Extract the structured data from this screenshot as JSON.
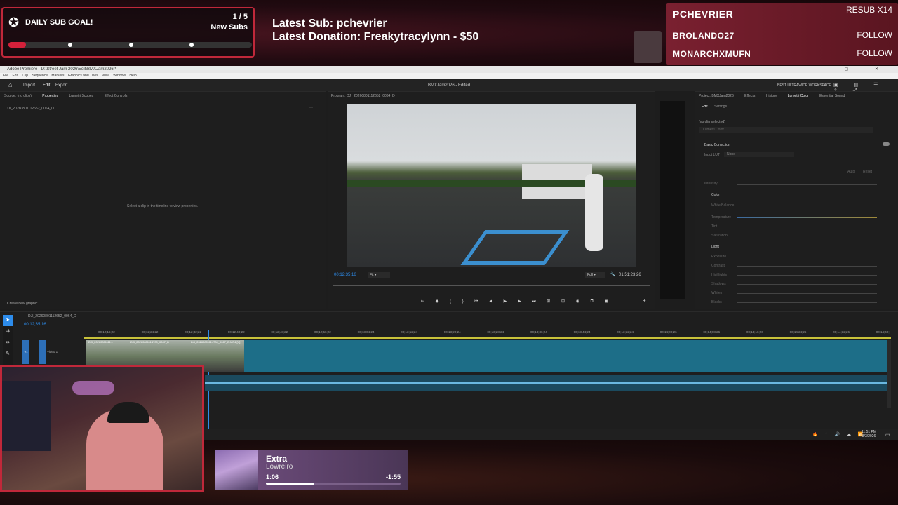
{
  "overlay": {
    "goal": {
      "title": "DAILY SUB GOAL!",
      "count": "1 / 5",
      "label": "New Subs",
      "progress": 0.2
    },
    "latest_sub": "Latest Sub: pchevrier",
    "latest_donation": "Latest Donation: Freakytracylynn  - $50",
    "events": [
      {
        "name": "PCHEVRIER",
        "type": "RESUB X14"
      },
      {
        "name": "BROLANDO27",
        "type": "FOLLOW"
      },
      {
        "name": "MONARCHXMUFN",
        "type": "FOLLOW"
      }
    ]
  },
  "app": {
    "window_title": "Adobe Premiere - D:\\Street Jam 2026\\Edit\\BMXJam2026 *",
    "menu": [
      "File",
      "Edit",
      "Clip",
      "Sequence",
      "Markers",
      "Graphics and Titles",
      "View",
      "Window",
      "Help"
    ],
    "toolbar": {
      "import": "Import",
      "edit": "Edit",
      "export": "Export",
      "project_title": "BMXJam2026 - Edited",
      "workspace": "BEST ULTRAWIDE WORKSPACE"
    },
    "left_tabs": [
      "Source: (no clips)",
      "Properties",
      "Lumetri Scopes",
      "Effect Controls"
    ],
    "clip_name": "DJI_20260801112652_0064_D",
    "properties_empty": "Select a clip in the timeline to view properties.",
    "create_graphic": "Create new graphic",
    "program_tab": "Program: DJI_20260801112652_0064_D",
    "timecode_current": "00;12;35;16",
    "fit": "Fit",
    "full": "Full",
    "timecode_duration": "01;51;23;26",
    "right_tabs": [
      "Project: BMXJam2026",
      "Effects",
      "History",
      "Lumetri Color",
      "Essential Sound"
    ],
    "lumetri": {
      "edit": "Edit",
      "settings": "Settings",
      "no_clip": "(no clip selected)",
      "lumetri_color": "Lumetri Color",
      "basic_correction": "Basic Correction",
      "input_lut": "Input LUT",
      "none": "None",
      "auto": "Auto",
      "reset": "Reset",
      "intensity": "Intensity",
      "color": "Color",
      "white_balance": "White Balance",
      "color_sliders": [
        "Temperature",
        "Tint",
        "Saturation"
      ],
      "light": "Light",
      "light_sliders": [
        "Exposure",
        "Contrast",
        "Highlights",
        "Shadows",
        "Whites",
        "Blacks"
      ]
    },
    "sequence_tab": "DJI_20260801112652_0064_D",
    "seq_timecode": "00;12;35;16",
    "ruler": [
      "00;12;16;22",
      "00;12;24;22",
      "00;12;32;22",
      "00;12;40;22",
      "00;12;48;22",
      "00;12;56;22",
      "00;13;04;24",
      "00;13;12;24",
      "00;13;20;24",
      "00;13;28;24",
      "00;13;36;24",
      "00;13;44;24",
      "00;13;52;24",
      "00;14;00;26",
      "00;14;08;26",
      "00;14;16;26",
      "00;14;24;26",
      "00;14;32;26",
      "00;14;40;"
    ],
    "track_v1": "V1",
    "track_label": "Video 1",
    "clips": [
      "DJI_20260801111...",
      "DJI_20260801114700_0067_D",
      "DJI_20260801114700_0067_D.MP4 [V]"
    ],
    "clock_time": "11:51 PM",
    "clock_date": "8/3/2026"
  },
  "now_playing": {
    "title": "Extra",
    "artist": "Lowreiro",
    "elapsed": "1:06",
    "remaining": "-1:55",
    "progress": 0.36
  },
  "colors": {
    "accent_red": "#c0283a",
    "premiere_blue": "#2d8ceb",
    "clip_teal": "#1d6e88"
  }
}
